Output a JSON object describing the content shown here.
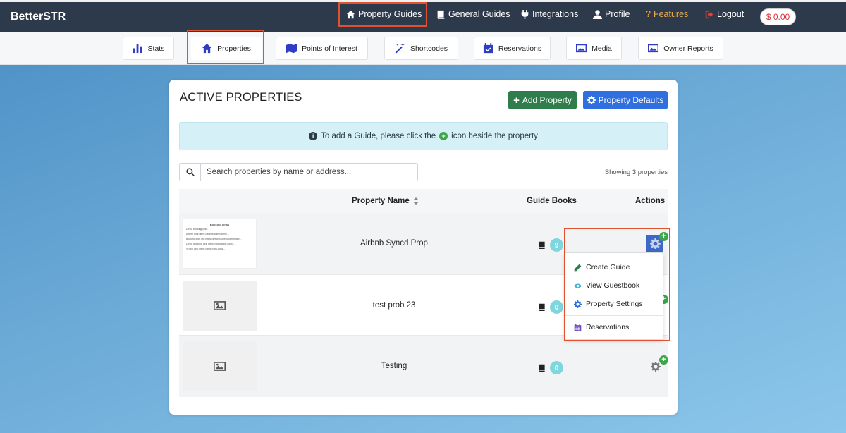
{
  "topbar": {
    "brand": "BetterSTR",
    "nav": [
      {
        "label": "Property Guides",
        "icon": "home-icon"
      },
      {
        "label": "General Guides",
        "icon": "book-icon"
      },
      {
        "label": "Integrations",
        "icon": "plug-icon"
      },
      {
        "label": "Profile",
        "icon": "user-icon"
      },
      {
        "label": "Features",
        "icon": "question-icon"
      },
      {
        "label": "Logout",
        "icon": "logout-icon"
      }
    ],
    "balance": "$ 0.00",
    "colors": {
      "features": "#f0ad4e",
      "logout_icon": "#e0443a"
    }
  },
  "subnav": {
    "tabs": [
      {
        "label": "Stats",
        "icon": "bar-chart-icon"
      },
      {
        "label": "Properties",
        "icon": "home-icon"
      },
      {
        "label": "Points of Interest",
        "icon": "map-icon"
      },
      {
        "label": "Shortcodes",
        "icon": "magic-wand-icon"
      },
      {
        "label": "Reservations",
        "icon": "calendar-check-icon"
      },
      {
        "label": "Media",
        "icon": "images-icon"
      },
      {
        "label": "Owner Reports",
        "icon": "images-icon"
      }
    ]
  },
  "main": {
    "title": "ACTIVE PROPERTIES",
    "add_property": "Add Property",
    "property_defaults": "Property Defaults",
    "info_text_before": "To add a Guide, please click the",
    "info_text_after": "icon beside the property",
    "search_placeholder": "Search properties by name or address...",
    "showing": "Showing 3 properties",
    "columns": {
      "name": "Property Name",
      "guides": "Guide Books",
      "actions": "Actions"
    },
    "rows": [
      {
        "name": "Airbnb Syncd Prop",
        "guides": "9",
        "thumbnail": "document-preview"
      },
      {
        "name": "test prob 23",
        "guides": "0",
        "thumbnail": "image-placeholder-icon"
      },
      {
        "name": "Testing",
        "guides": "0",
        "thumbnail": "image-placeholder-icon"
      }
    ],
    "thumbnail_doc": {
      "heading": "Booking Links",
      "intro": "Direct booking links",
      "lines": [
        "Airbnb Link https://airbnb.com/rooms/...",
        "Booking.com link https://www.booking.com/hotel/...",
        "Direct Booking Link https://hospitable.com/...",
        "VRBO Link https://www.vrbo.com/..."
      ]
    }
  },
  "actions_menu": {
    "items": [
      {
        "label": "Create Guide",
        "icon": "pencil-icon",
        "color": "#2f7d4b"
      },
      {
        "label": "View Guestbook",
        "icon": "eye-icon",
        "color": "#3ab7d8"
      },
      {
        "label": "Property Settings",
        "icon": "gear-icon",
        "color": "#2f6fe0"
      },
      {
        "label": "Reservations",
        "icon": "calendar-icon",
        "color": "#6a4cc2"
      }
    ]
  }
}
